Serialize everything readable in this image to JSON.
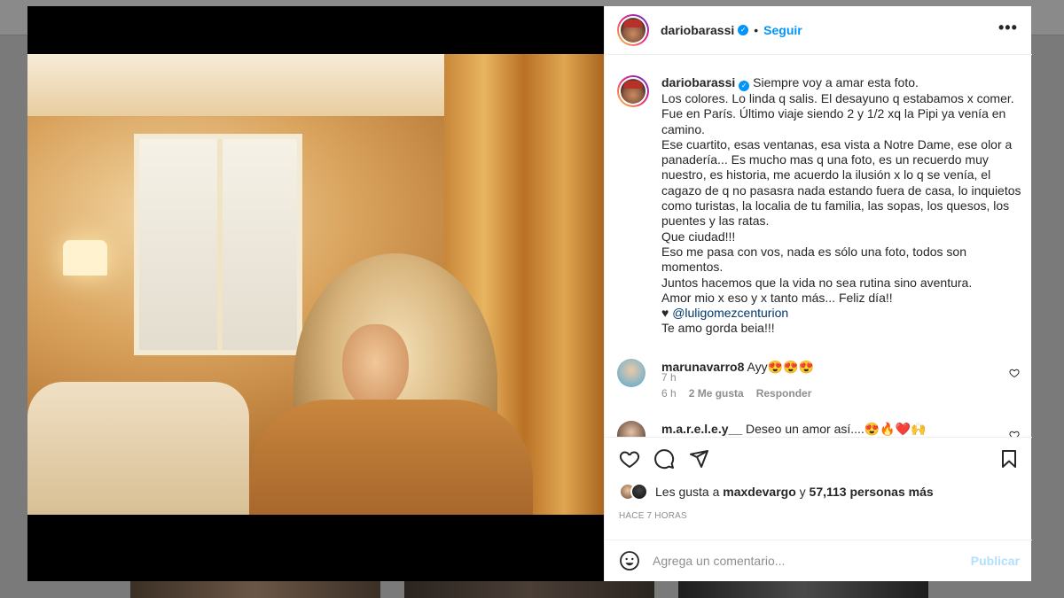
{
  "post": {
    "username": "dariobarassi",
    "follow_label": "Seguir",
    "dot": "•",
    "more": "•••",
    "caption": "Siempre voy a amar esta foto.\nLos colores. Lo linda q salis. El desayuno q estabamos x comer.\nFue en París. Último viaje siendo 2 y 1/2 xq la Pipi ya venía en camino.\nEse cuartito, esas ventanas, esa vista a Notre Dame, ese olor a panadería... Es mucho mas q una foto, es un recuerdo muy nuestro, es historia, me acuerdo la ilusión x lo q se venía, el cagazo de q no pasasra nada estando fuera de casa, lo inquietos como turistas, la localia de tu familia, las sopas, los quesos, los puentes y las ratas.\nQue ciudad!!!\nEso me pasa con vos, nada es sólo una foto, todos son momentos.\nJuntos hacemos que la vida no sea rutina sino aventura.\nAmor mio x eso y x tanto más... Feliz día!!",
    "caption_heart": "♥ ",
    "mention": "@luligomezcenturion",
    "caption_end": "Te amo gorda beia!!!",
    "caption_time": "7 h",
    "likes_prefix": "Les gusta a ",
    "likes_user": "maxdevargo",
    "likes_and": " y ",
    "likes_count": "57,113 personas más",
    "time_ago": "Hace 7 horas"
  },
  "comments": [
    {
      "username": "marunavarro8",
      "text": "Ayy😍😍😍",
      "time": "6 h",
      "likes": "2 Me gusta",
      "reply": "Responder"
    },
    {
      "username": "m.a.r.e.l.e.y__",
      "text": "Deseo un amor así....😍🔥❤️🙌"
    }
  ],
  "add_comment": {
    "placeholder": "Agrega un comentario...",
    "publish": "Publicar"
  },
  "icons": {
    "like": "heart-icon",
    "comment": "comment-icon",
    "share": "paper-plane-icon",
    "save": "bookmark-icon",
    "emoji": "emoji-icon",
    "verified": "verified-badge-icon"
  },
  "colors": {
    "accent": "#0095f6",
    "publish_disabled": "#b2dffc",
    "muted": "#8e8e8e",
    "mention": "#00376b"
  }
}
